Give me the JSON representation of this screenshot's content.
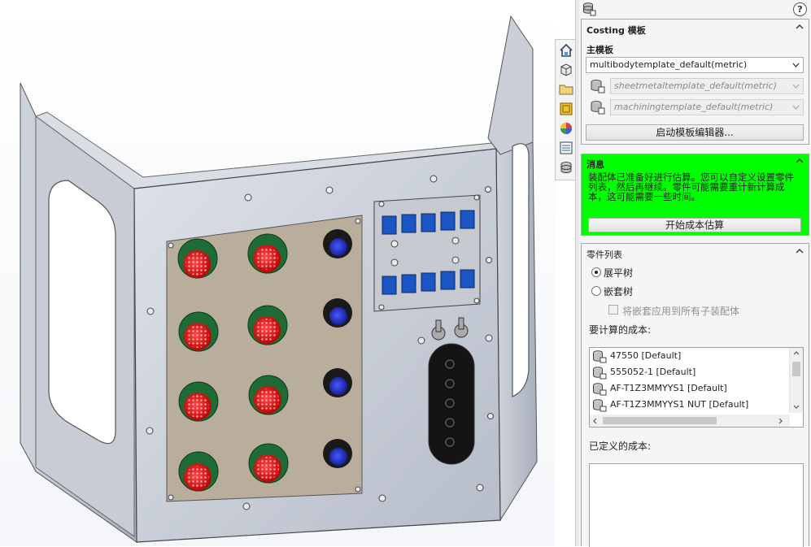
{
  "toolbar": {
    "items": [
      {
        "icon": "home-icon"
      },
      {
        "icon": "part-box-icon"
      },
      {
        "icon": "folder-icon"
      },
      {
        "icon": "design-library-icon"
      },
      {
        "icon": "appearance-color-icon"
      },
      {
        "icon": "custom-properties-icon"
      },
      {
        "icon": "costing-icon"
      }
    ]
  },
  "panel": {
    "template_section": {
      "title": "Costing 模板",
      "main_template_label": "主模板",
      "main_template_value": "multibodytemplate_default(metric)",
      "sheetmetal_value": "sheetmetaltemplate_default(metric)",
      "machining_value": "machiningtemplate_default(metric)",
      "launch_editor_label": "启动模板编辑器..."
    },
    "message_section": {
      "title": "消息",
      "text": "装配体已准备好进行估算。您可以自定义设置零件列表，然后再继续。零件可能需要重计新计算成本，这可能需要一些时间。",
      "start_button": "开始成本估算",
      "color": "#00ff00"
    },
    "parts_section": {
      "title": "零件列表",
      "flat_tree_label": "展平树",
      "nested_tree_label": "嵌套树",
      "apply_nested_label": "将嵌套应用到所有子装配体",
      "to_calculate_label": "要计算的成本:",
      "items": [
        "47550 [Default]",
        "555052-1 [Default]",
        "AF-T1Z3MMYYS1 [Default]",
        "AF-T1Z3MMYYS1 NUT [Default]"
      ],
      "defined_label": "已定义的成本:"
    }
  }
}
